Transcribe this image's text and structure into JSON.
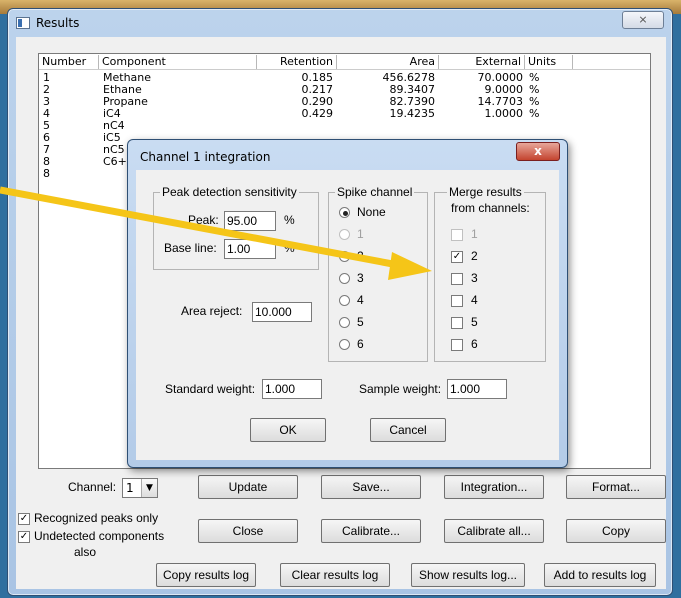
{
  "window": {
    "title": "Results",
    "close_glyph": "⨯"
  },
  "table": {
    "headers": [
      "Number",
      "Component",
      "Retention",
      "Area",
      "External",
      "Units"
    ],
    "rows": [
      [
        "1",
        "Methane",
        "0.185",
        "456.6278",
        "70.0000",
        "%"
      ],
      [
        "2",
        "Ethane",
        "0.217",
        "89.3407",
        "9.0000",
        "%"
      ],
      [
        "3",
        "Propane",
        "0.290",
        "82.7390",
        "14.7703",
        "%"
      ],
      [
        "4",
        "iC4",
        "0.429",
        "19.4235",
        "1.0000",
        "%"
      ],
      [
        "5",
        "nC4",
        "",
        "",
        "",
        ""
      ],
      [
        "6",
        "iC5",
        "",
        "",
        "",
        ""
      ],
      [
        "7",
        "nC5",
        "",
        "",
        "",
        ""
      ],
      [
        "8",
        "C6+",
        "",
        "",
        "",
        ""
      ],
      [
        "8",
        "",
        "",
        "",
        "",
        ""
      ]
    ]
  },
  "controls": {
    "channel_label": "Channel:",
    "channel_value": "1",
    "update": "Update",
    "save": "Save...",
    "integration": "Integration...",
    "format": "Format...",
    "recognized_peaks_only": "Recognized peaks only",
    "undetected_components": "Undetected components",
    "undetected_also": "also",
    "close": "Close",
    "calibrate": "Calibrate...",
    "calibrate_all": "Calibrate all...",
    "copy": "Copy",
    "copy_results_log": "Copy results log",
    "clear_results_log": "Clear results log",
    "show_results_log": "Show results log...",
    "add_to_results_log": "Add to results log"
  },
  "dialog": {
    "title": "Channel 1 integration",
    "close_glyph": "x",
    "peak_group": "Peak detection sensitivity",
    "peak_label": "Peak:",
    "peak_value": "95.00",
    "base_label": "Base line:",
    "base_value": "1.00",
    "percent": "%",
    "area_reject_label": "Area reject:",
    "area_reject_value": "10.000",
    "spike_group": "Spike channel",
    "spike_options": [
      "None",
      "1",
      "2",
      "3",
      "4",
      "5",
      "6"
    ],
    "merge_group_line1": "Merge results",
    "merge_group_line2": "from channels:",
    "merge_options": [
      "1",
      "2",
      "3",
      "4",
      "5",
      "6"
    ],
    "standard_weight_label": "Standard weight:",
    "standard_weight_value": "1.000",
    "sample_weight_label": "Sample weight:",
    "sample_weight_value": "1.000",
    "ok": "OK",
    "cancel": "Cancel"
  },
  "colors": {
    "annotation_arrow": "#f5c518"
  }
}
